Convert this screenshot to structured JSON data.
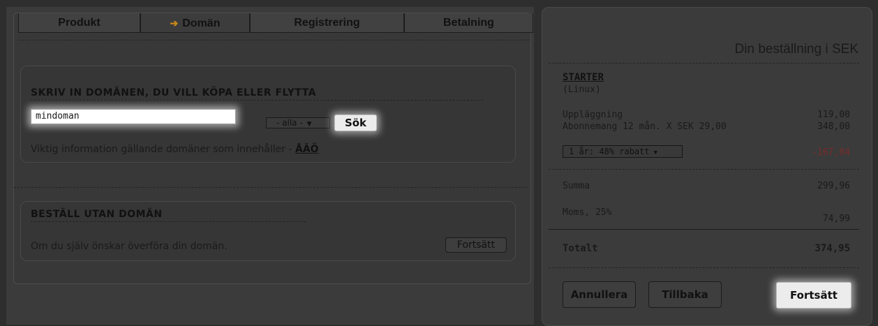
{
  "tabs": [
    {
      "label": "Produkt",
      "active": false
    },
    {
      "label": "Domän",
      "active": true
    },
    {
      "label": "Registrering",
      "active": false
    },
    {
      "label": "Betalning",
      "active": false
    }
  ],
  "domain_box": {
    "title": "SKRIV IN DOMÄNEN, DU VILL KÖPA ELLER FLYTTA",
    "input_value": "mindoman",
    "tld_selected": "- alla -",
    "search_label": "Sök",
    "info_text": "Viktig information gällande domäner som innehåller - ",
    "info_link": "ÅÄÖ"
  },
  "no_domain_box": {
    "title": "BESTÄLL UTAN DOMÄN",
    "text": "Om du själv önskar överföra din domän.",
    "continue_label": "Fortsätt"
  },
  "order": {
    "heading": "Din beställning i SEK",
    "product": "STARTER",
    "product_sub": "(Linux)",
    "lines": [
      {
        "label": "Uppläggning",
        "value": "119,00"
      },
      {
        "label": "Abonnemang 12 mån. X SEK 29,00",
        "value": "348,00"
      }
    ],
    "discount_selected": "1 år: 48% rabatt",
    "discount_value": "-167,04",
    "sum_label": "Summa",
    "sum_value": "299,96",
    "vat_label": "Moms, 25%",
    "vat_value": "74,99",
    "total_label": "Totalt",
    "total_value": "374,95"
  },
  "actions": {
    "cancel": "Annullera",
    "back": "Tillbaka",
    "continue": "Fortsätt"
  },
  "colors": {
    "arrow": "#c9891a",
    "discount": "#7a2b2b"
  }
}
